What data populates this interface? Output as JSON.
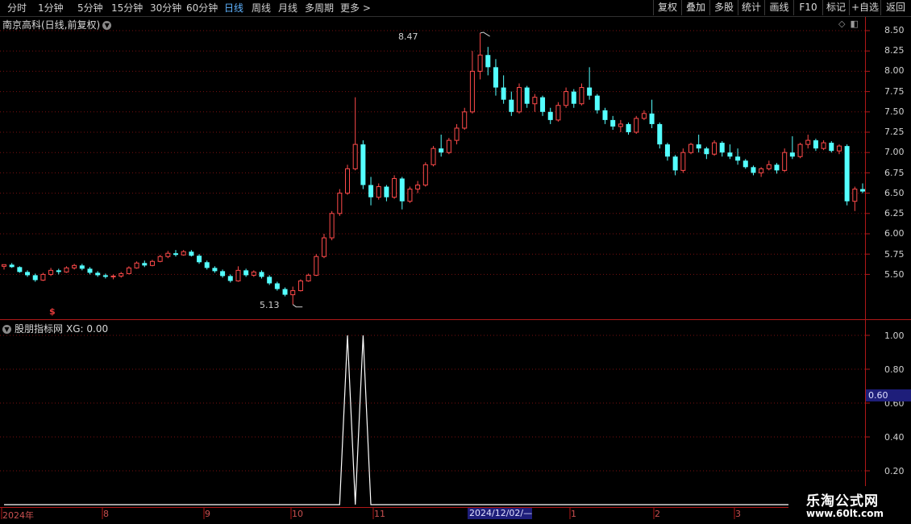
{
  "toolbar": {
    "periods": [
      "分时",
      "1分钟",
      "5分钟",
      "15分钟",
      "30分钟",
      "60分钟",
      "日线",
      "周线",
      "月线",
      "多周期",
      "更多 >"
    ],
    "active_period": "日线",
    "tools": [
      "复权",
      "叠加",
      "多股",
      "统计",
      "画线",
      "F10",
      "标记",
      "+自选",
      "返回"
    ]
  },
  "main_chart": {
    "title": "南京高科(日线,前复权)",
    "y_ticks": [
      "8.50",
      "8.25",
      "8.00",
      "7.75",
      "7.50",
      "7.25",
      "7.00",
      "6.75",
      "6.50",
      "6.25",
      "6.00",
      "5.75",
      "5.50"
    ],
    "high_label": "8.47",
    "low_label": "5.13",
    "event_mark": "$"
  },
  "indicator": {
    "title": "股朋指标网",
    "value_label": "XG: 0.00",
    "y_ticks": [
      "1.00",
      "0.80",
      "0.60",
      "0.40",
      "0.20"
    ],
    "cursor_value": "0.60"
  },
  "x_axis": {
    "labels": [
      "2024年",
      "8",
      "9",
      "10",
      "11",
      "1",
      "2",
      "3"
    ],
    "cursor_date": "2024/12/02/—"
  },
  "watermark": {
    "line1": "乐淘公式网",
    "line2": "www.60lt.com"
  },
  "colors": {
    "up": "#ff4a4a",
    "down": "#54ffff",
    "grid": "#7a1010",
    "axis": "#b01818",
    "cursor": "#1e1e7a"
  },
  "chart_data": {
    "type": "candlestick",
    "title": "南京高科(日线,前复权)",
    "ylim": [
      5.13,
      8.47
    ],
    "series": [
      {
        "values": [
          [
            5.6,
            5.62,
            5.56,
            5.62
          ],
          [
            5.62,
            5.64,
            5.58,
            5.59
          ],
          [
            5.59,
            5.6,
            5.52,
            5.53
          ],
          [
            5.53,
            5.55,
            5.47,
            5.49
          ],
          [
            5.49,
            5.51,
            5.41,
            5.43
          ],
          [
            5.43,
            5.52,
            5.42,
            5.5
          ],
          [
            5.5,
            5.58,
            5.48,
            5.55
          ],
          [
            5.55,
            5.57,
            5.5,
            5.53
          ],
          [
            5.53,
            5.6,
            5.52,
            5.58
          ],
          [
            5.58,
            5.63,
            5.56,
            5.61
          ],
          [
            5.61,
            5.63,
            5.55,
            5.57
          ],
          [
            5.57,
            5.59,
            5.5,
            5.52
          ],
          [
            5.52,
            5.54,
            5.47,
            5.49
          ],
          [
            5.49,
            5.51,
            5.45,
            5.47
          ],
          [
            5.47,
            5.5,
            5.44,
            5.48
          ],
          [
            5.48,
            5.53,
            5.46,
            5.51
          ],
          [
            5.51,
            5.6,
            5.5,
            5.58
          ],
          [
            5.58,
            5.66,
            5.57,
            5.64
          ],
          [
            5.64,
            5.67,
            5.59,
            5.61
          ],
          [
            5.61,
            5.68,
            5.6,
            5.66
          ],
          [
            5.66,
            5.74,
            5.65,
            5.72
          ],
          [
            5.72,
            5.79,
            5.7,
            5.76
          ],
          [
            5.76,
            5.8,
            5.72,
            5.74
          ],
          [
            5.74,
            5.8,
            5.73,
            5.78
          ],
          [
            5.78,
            5.8,
            5.72,
            5.73
          ],
          [
            5.73,
            5.75,
            5.63,
            5.65
          ],
          [
            5.65,
            5.67,
            5.56,
            5.58
          ],
          [
            5.58,
            5.6,
            5.52,
            5.54
          ],
          [
            5.54,
            5.56,
            5.46,
            5.48
          ],
          [
            5.48,
            5.5,
            5.4,
            5.42
          ],
          [
            5.42,
            5.6,
            5.41,
            5.55
          ],
          [
            5.55,
            5.57,
            5.47,
            5.49
          ],
          [
            5.49,
            5.55,
            5.47,
            5.53
          ],
          [
            5.53,
            5.55,
            5.45,
            5.47
          ],
          [
            5.47,
            5.49,
            5.37,
            5.39
          ],
          [
            5.39,
            5.41,
            5.3,
            5.32
          ],
          [
            5.32,
            5.34,
            5.23,
            5.25
          ],
          [
            5.25,
            5.35,
            5.13,
            5.3
          ],
          [
            5.3,
            5.44,
            5.29,
            5.42
          ],
          [
            5.42,
            5.51,
            5.41,
            5.49
          ],
          [
            5.49,
            5.75,
            5.48,
            5.72
          ],
          [
            5.72,
            6.0,
            5.7,
            5.95
          ],
          [
            5.95,
            6.28,
            5.92,
            6.25
          ],
          [
            6.25,
            6.55,
            6.22,
            6.5
          ],
          [
            6.5,
            6.85,
            6.48,
            6.8
          ],
          [
            6.8,
            7.68,
            6.78,
            7.1
          ],
          [
            7.1,
            7.15,
            6.55,
            6.6
          ],
          [
            6.6,
            6.7,
            6.35,
            6.45
          ],
          [
            6.45,
            6.62,
            6.42,
            6.58
          ],
          [
            6.58,
            6.6,
            6.4,
            6.45
          ],
          [
            6.45,
            6.72,
            6.43,
            6.68
          ],
          [
            6.68,
            6.7,
            6.3,
            6.4
          ],
          [
            6.4,
            6.58,
            6.38,
            6.55
          ],
          [
            6.55,
            6.65,
            6.5,
            6.6
          ],
          [
            6.6,
            6.88,
            6.58,
            6.85
          ],
          [
            6.85,
            7.08,
            6.83,
            7.05
          ],
          [
            7.05,
            7.22,
            6.95,
            7.0
          ],
          [
            7.0,
            7.18,
            6.98,
            7.15
          ],
          [
            7.15,
            7.35,
            7.1,
            7.3
          ],
          [
            7.3,
            7.55,
            7.28,
            7.5
          ],
          [
            7.5,
            8.25,
            7.48,
            8.0
          ],
          [
            8.0,
            8.47,
            7.9,
            8.2
          ],
          [
            8.2,
            8.3,
            7.95,
            8.05
          ],
          [
            8.05,
            8.15,
            7.7,
            7.8
          ],
          [
            7.8,
            7.95,
            7.6,
            7.65
          ],
          [
            7.65,
            7.75,
            7.45,
            7.5
          ],
          [
            7.5,
            7.85,
            7.48,
            7.8
          ],
          [
            7.8,
            7.82,
            7.55,
            7.6
          ],
          [
            7.6,
            7.72,
            7.5,
            7.68
          ],
          [
            7.68,
            7.7,
            7.45,
            7.5
          ],
          [
            7.5,
            7.55,
            7.35,
            7.4
          ],
          [
            7.4,
            7.62,
            7.38,
            7.58
          ],
          [
            7.58,
            7.8,
            7.55,
            7.75
          ],
          [
            7.75,
            7.78,
            7.55,
            7.6
          ],
          [
            7.6,
            7.85,
            7.58,
            7.8
          ],
          [
            7.8,
            8.05,
            7.65,
            7.7
          ],
          [
            7.7,
            7.72,
            7.48,
            7.52
          ],
          [
            7.52,
            7.55,
            7.35,
            7.4
          ],
          [
            7.4,
            7.45,
            7.28,
            7.32
          ],
          [
            7.32,
            7.4,
            7.25,
            7.35
          ],
          [
            7.35,
            7.37,
            7.22,
            7.25
          ],
          [
            7.25,
            7.45,
            7.23,
            7.42
          ],
          [
            7.42,
            7.52,
            7.4,
            7.48
          ],
          [
            7.48,
            7.65,
            7.3,
            7.35
          ],
          [
            7.35,
            7.37,
            7.05,
            7.1
          ],
          [
            7.1,
            7.12,
            6.9,
            6.95
          ],
          [
            6.95,
            6.97,
            6.72,
            6.78
          ],
          [
            6.78,
            7.05,
            6.75,
            7.0
          ],
          [
            7.0,
            7.12,
            6.98,
            7.1
          ],
          [
            7.1,
            7.22,
            7.0,
            7.05
          ],
          [
            7.05,
            7.07,
            6.92,
            6.98
          ],
          [
            6.98,
            7.15,
            6.96,
            7.12
          ],
          [
            7.12,
            7.14,
            6.95,
            7.0
          ],
          [
            7.0,
            7.1,
            6.92,
            6.95
          ],
          [
            6.95,
            7.05,
            6.85,
            6.9
          ],
          [
            6.9,
            6.92,
            6.8,
            6.82
          ],
          [
            6.82,
            6.84,
            6.72,
            6.75
          ],
          [
            6.75,
            6.82,
            6.7,
            6.8
          ],
          [
            6.8,
            6.9,
            6.78,
            6.85
          ],
          [
            6.85,
            6.87,
            6.74,
            6.78
          ],
          [
            6.78,
            7.05,
            6.76,
            7.0
          ],
          [
            7.0,
            7.2,
            6.92,
            6.95
          ],
          [
            6.95,
            7.12,
            6.93,
            7.1
          ],
          [
            7.1,
            7.22,
            7.05,
            7.15
          ],
          [
            7.15,
            7.17,
            7.02,
            7.05
          ],
          [
            7.05,
            7.15,
            7.03,
            7.12
          ],
          [
            7.12,
            7.14,
            7.0,
            7.02
          ],
          [
            7.02,
            7.1,
            6.98,
            7.08
          ],
          [
            7.08,
            7.1,
            6.35,
            6.4
          ],
          [
            6.4,
            6.58,
            6.28,
            6.55
          ],
          [
            6.55,
            6.62,
            6.5,
            6.52
          ]
        ]
      }
    ],
    "indicator": {
      "name": "XG",
      "ylim": [
        0,
        1.05
      ],
      "values": [
        0,
        0,
        0,
        0,
        0,
        0,
        0,
        0,
        0,
        0,
        0,
        0,
        0,
        0,
        0,
        0,
        0,
        0,
        0,
        0,
        0,
        0,
        0,
        0,
        0,
        0,
        0,
        0,
        0,
        0,
        0,
        0,
        0,
        0,
        0,
        0,
        0,
        0,
        0,
        0,
        0,
        0,
        0,
        0,
        1,
        0,
        1,
        0,
        0,
        0,
        0,
        0,
        0,
        0,
        0,
        0,
        0,
        0,
        0,
        0,
        0,
        0,
        0,
        0,
        0,
        0,
        0,
        0,
        0,
        0,
        0,
        0,
        0,
        0,
        0,
        0,
        0,
        0,
        0,
        0,
        0,
        0,
        0,
        0,
        0,
        0,
        0,
        0,
        0,
        0,
        0,
        0,
        0,
        0,
        0,
        0,
        0,
        0,
        0,
        0,
        0,
        0,
        0,
        0,
        0,
        0,
        0,
        0,
        0,
        0,
        0,
        0
      ]
    }
  }
}
